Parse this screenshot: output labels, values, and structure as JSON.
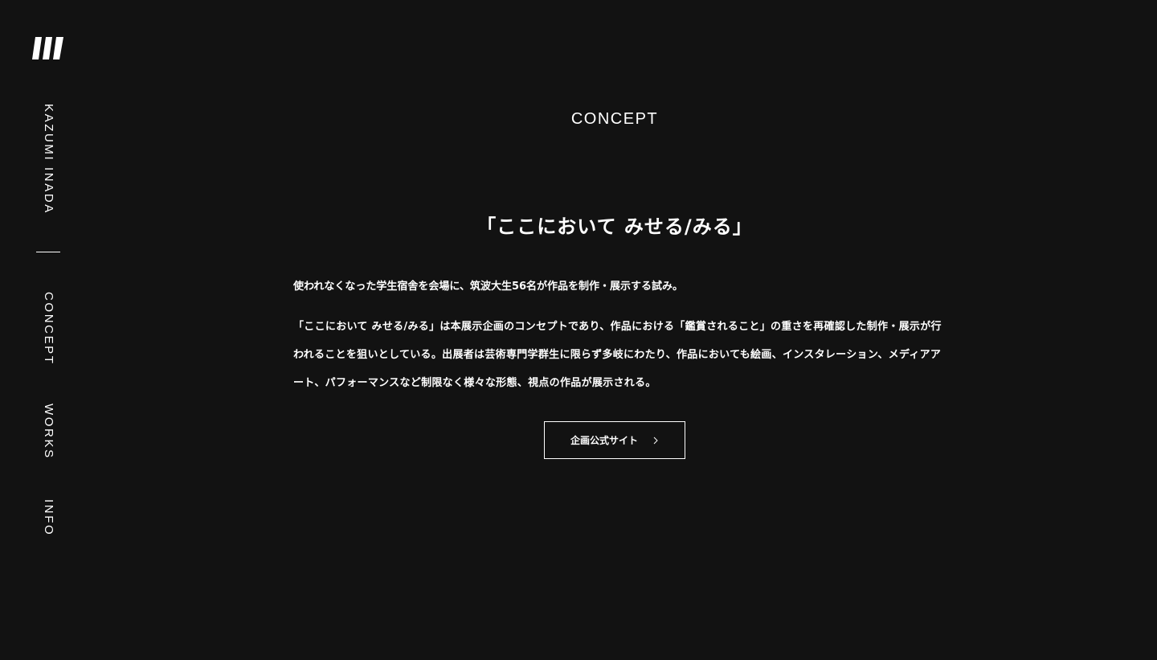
{
  "sidebar": {
    "logo_icon": "stripes-logo-icon",
    "items": [
      {
        "label": "KAZUMI INADA"
      },
      {
        "label": "CONCEPT"
      },
      {
        "label": "WORKS"
      },
      {
        "label": "INFO"
      }
    ]
  },
  "main": {
    "section_heading": "CONCEPT",
    "title": "「ここにおいて みせる/みる」",
    "lead": "使われなくなった学生宿舎を会場に、筑波大生56名が作品を制作・展示する試み。",
    "description": "「ここにおいて みせる/みる」は本展示企画のコンセプトであり、作品における「鑑賞されること」の重さを再確認した制作・展示が行われることを狙いとしている。出展者は芸術専門学群生に限らず多岐にわたり、作品においても絵画、インスタレーション、メディアアート、パフォーマンスなど制限なく様々な形態、視点の作品が展示される。",
    "button_label": "企画公式サイト",
    "button_icon": "chevron-right-icon"
  },
  "colors": {
    "background": "#121212",
    "text": "#ffffff"
  }
}
